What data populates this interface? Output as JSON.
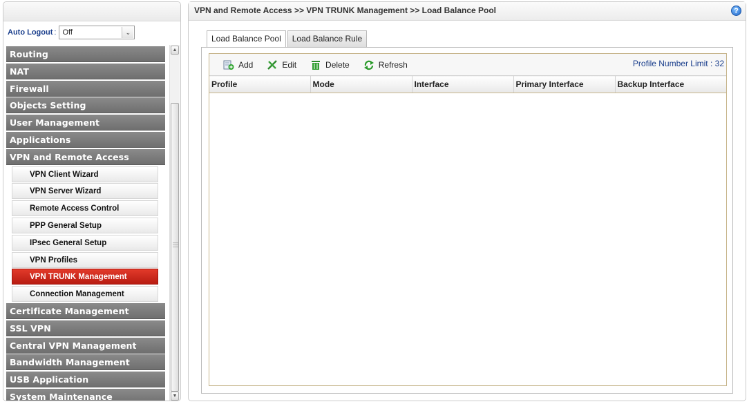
{
  "sidebar": {
    "auto_logout_label": "Auto Logout",
    "auto_logout_colon": ":",
    "auto_logout_value": "Off",
    "menu": [
      {
        "label": "Routing"
      },
      {
        "label": "NAT"
      },
      {
        "label": "Firewall"
      },
      {
        "label": "Objects Setting"
      },
      {
        "label": "User Management"
      },
      {
        "label": "Applications"
      },
      {
        "label": "VPN and Remote Access"
      }
    ],
    "submenu": [
      {
        "label": "VPN Client Wizard"
      },
      {
        "label": "VPN Server Wizard"
      },
      {
        "label": "Remote Access Control"
      },
      {
        "label": "PPP General Setup"
      },
      {
        "label": "IPsec General Setup"
      },
      {
        "label": "VPN Profiles"
      },
      {
        "label": "VPN TRUNK Management"
      },
      {
        "label": "Connection Management"
      }
    ],
    "menu_after": [
      {
        "label": "Certificate Management"
      },
      {
        "label": "SSL VPN"
      },
      {
        "label": "Central VPN Management"
      },
      {
        "label": "Bandwidth Management"
      },
      {
        "label": "USB Application"
      },
      {
        "label": "System Maintenance"
      }
    ]
  },
  "main": {
    "breadcrumb": "VPN and Remote Access >> VPN TRUNK Management >> Load Balance Pool",
    "tabs": [
      {
        "label": "Load Balance Pool"
      },
      {
        "label": "Load Balance Rule"
      }
    ],
    "toolbar": {
      "add": "Add",
      "edit": "Edit",
      "delete": "Delete",
      "refresh": "Refresh",
      "limit_label": "Profile Number Limit :",
      "limit_value": "32"
    },
    "table": {
      "columns": [
        "Profile",
        "Mode",
        "Interface",
        "Primary Interface",
        "Backup Interface"
      ]
    }
  },
  "colors": {
    "menu_bg": "#7c7c7c",
    "active_bg": "#d0281c",
    "link_blue": "#1a3e8c"
  }
}
